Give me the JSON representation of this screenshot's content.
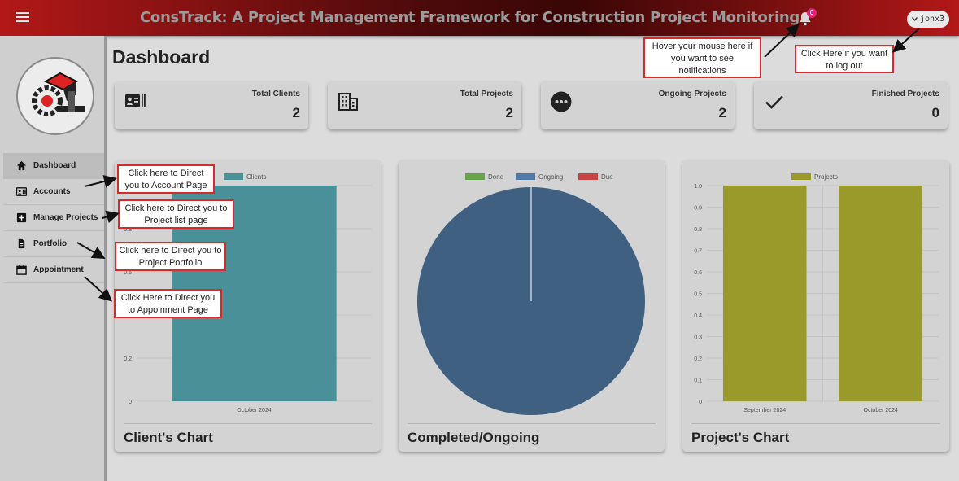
{
  "header": {
    "title": "ConsTrack: A Project Management Framework for Construction Project Monitoring",
    "notification_count": "0",
    "username": "jonx3",
    "menu_icon": "menu-icon",
    "bell_icon": "bell-icon",
    "user_caret_icon": "chevron-down-icon"
  },
  "sidebar": {
    "logo": "constrack-logo",
    "items": [
      {
        "label": "Dashboard",
        "icon": "home-icon",
        "active": true
      },
      {
        "label": "Accounts",
        "icon": "id-card-icon"
      },
      {
        "label": "Manage Projects",
        "icon": "plus-box-icon"
      },
      {
        "label": "Portfolio",
        "icon": "document-icon"
      },
      {
        "label": "Appointment",
        "icon": "calendar-icon"
      }
    ]
  },
  "page": {
    "title": "Dashboard"
  },
  "stats": [
    {
      "label": "Total Clients",
      "value": "2",
      "icon": "id-card-icon"
    },
    {
      "label": "Total Projects",
      "value": "2",
      "icon": "building-icon"
    },
    {
      "label": "Ongoing Projects",
      "value": "2",
      "icon": "more-dots-icon"
    },
    {
      "label": "Finished Projects",
      "value": "0",
      "icon": "check-icon"
    }
  ],
  "panels": {
    "clients": {
      "title": "Client's Chart"
    },
    "status": {
      "title": "Completed/Ongoing"
    },
    "projects": {
      "title": "Project's Chart"
    }
  },
  "annotations": {
    "notifications": "Hover your mouse here if you want to see notifications",
    "logout": "Click Here if you want to log out",
    "accounts": "Click here to Direct you to Account Page",
    "projects": "Click here to Direct you to Project list page",
    "portfolio": "Click here to Direct you to Project Portfolio",
    "appointment": "Click Here to Direct you to Appoinment Page"
  },
  "colors": {
    "clients_bar": "#4a9099",
    "projects_bar": "#999a2a",
    "pie_ongoing": "#3f6080",
    "legend_done": "#69a34a",
    "legend_ongoing": "#5079a8",
    "legend_due": "#c84444"
  },
  "chart_data": [
    {
      "type": "bar",
      "categories": [
        "October 2024"
      ],
      "series": [
        {
          "name": "Clients",
          "values": [
            1
          ]
        }
      ],
      "yticks": [
        "0",
        "0.2",
        "0.4",
        "0.6",
        "0.8",
        "1.0"
      ],
      "ylim": [
        0,
        1
      ]
    },
    {
      "type": "pie",
      "labels": [
        "Done",
        "Ongoing",
        "Due"
      ],
      "values": [
        0,
        2,
        0
      ]
    },
    {
      "type": "bar",
      "categories": [
        "September 2024",
        "October 2024"
      ],
      "series": [
        {
          "name": "Projects",
          "values": [
            1,
            1
          ]
        }
      ],
      "yticks": [
        "0",
        "0.1",
        "0.2",
        "0.3",
        "0.4",
        "0.5",
        "0.6",
        "0.7",
        "0.8",
        "0.9",
        "1.0"
      ],
      "ylim": [
        0,
        1
      ]
    }
  ]
}
